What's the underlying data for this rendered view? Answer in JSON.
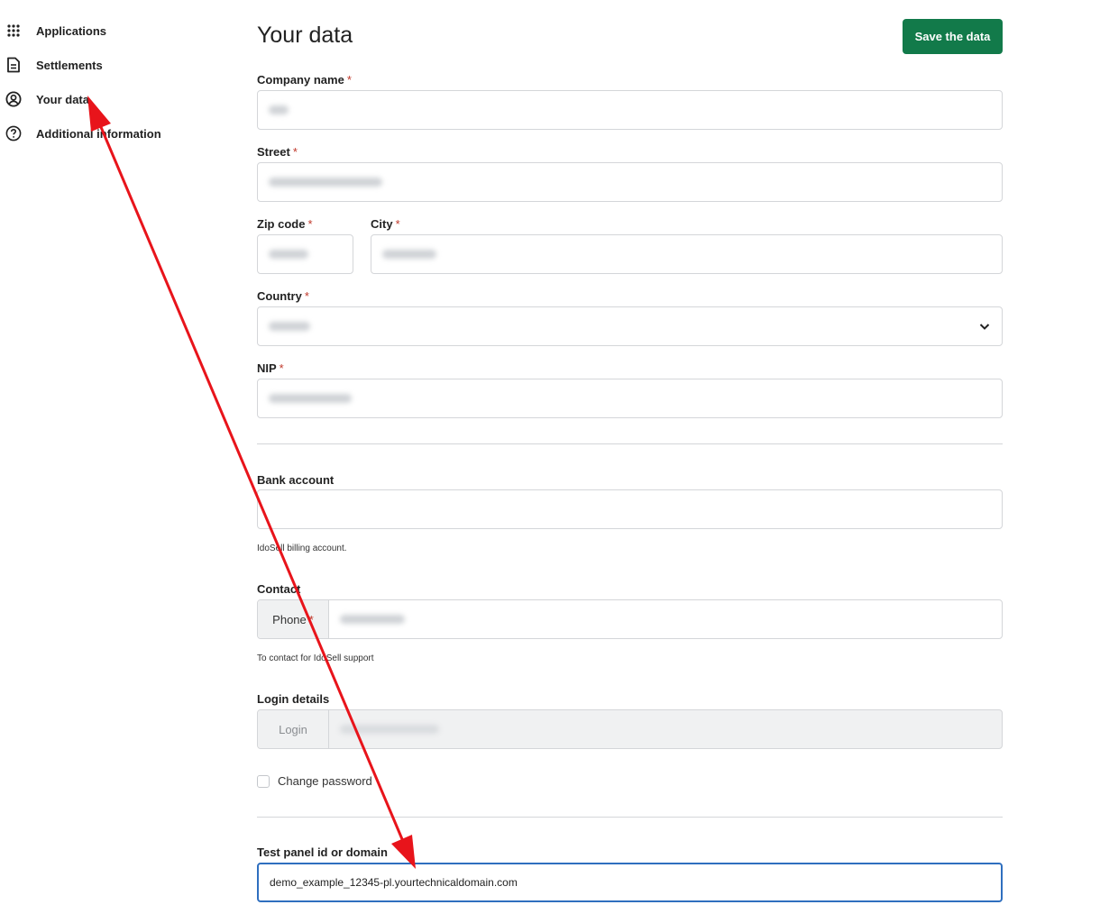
{
  "sidebar": {
    "items": [
      {
        "label": "Applications",
        "icon": "apps-grid-icon"
      },
      {
        "label": "Settlements",
        "icon": "document-icon"
      },
      {
        "label": "Your data",
        "icon": "user-circle-icon"
      },
      {
        "label": "Additional information",
        "icon": "help-circle-icon"
      }
    ]
  },
  "header": {
    "title": "Your data",
    "save_label": "Save the data"
  },
  "form": {
    "company_name": {
      "label": "Company name",
      "required": "*"
    },
    "street": {
      "label": "Street",
      "required": "*"
    },
    "zip_code": {
      "label": "Zip code",
      "required": "*"
    },
    "city": {
      "label": "City",
      "required": "*"
    },
    "country": {
      "label": "Country",
      "required": "*"
    },
    "nip": {
      "label": "NIP",
      "required": "*"
    },
    "bank_account": {
      "label": "Bank account",
      "hint": "IdoSell billing account."
    },
    "contact": {
      "label": "Contact",
      "phone_addon": "Phone",
      "required": "*",
      "hint": "To contact for IdoSell support"
    },
    "login_details": {
      "label": "Login details",
      "login_addon": "Login"
    },
    "change_password": {
      "label": "Change password"
    },
    "test_panel": {
      "label": "Test panel id or domain",
      "value": "demo_example_12345-pl.yourtechnicaldomain.com"
    }
  },
  "colors": {
    "save_button": "#127a4a",
    "required_mark": "#c0392b",
    "focus_border": "#2f6fbf",
    "annotation_arrow": "#e8141b"
  }
}
